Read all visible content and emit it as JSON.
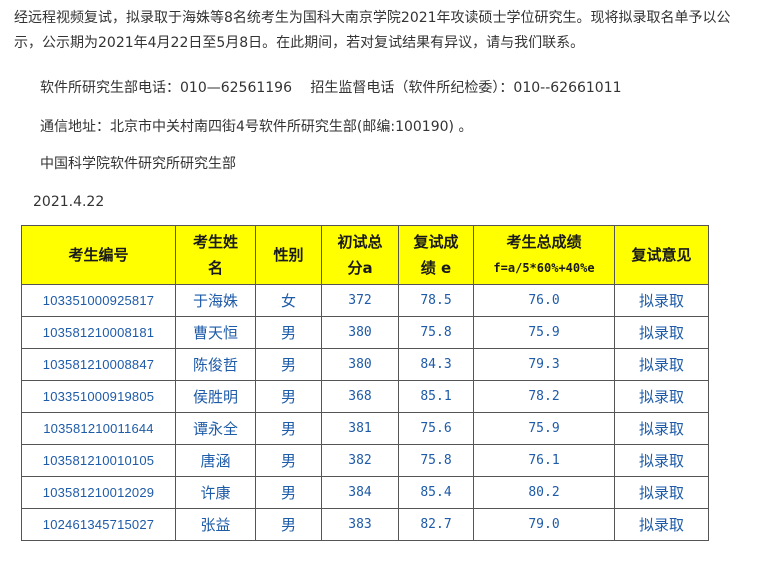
{
  "notice": {
    "intro": "经远程视频复试，拟录取于海姝等8名统考生为国科大南京学院2021年攻读硕士学位研究生。现将拟录取名单予以公示，公示期为2021年4月22日至5月8日。在此期间，若对复试结果有异议，请与我们联系。",
    "contact": "软件所研究生部电话：010—62561196　 招生监督电话（软件所纪检委）：010--62661011",
    "address": "通信地址：北京市中关村南四街4号软件所研究生部(邮编:100190) 。",
    "org": "中国科学院软件研究所研究生部",
    "date": "2021.4.22"
  },
  "table": {
    "headers": {
      "id": "考生编号",
      "name_line1": "考生姓",
      "name_line2": "名",
      "gender": "性别",
      "initial_line1": "初试总",
      "initial_line2": "分a",
      "retest_line1": "复试成",
      "retest_line2": "绩 e",
      "total_line1": "考生总成绩",
      "total_line2": "f=a/5*60%+40%e",
      "opinion": "复试意见"
    },
    "rows": [
      {
        "id": "103351000925817",
        "name": "于海姝",
        "gender": "女",
        "initial": "372",
        "retest": "78.5",
        "total": "76.0",
        "opinion": "拟录取"
      },
      {
        "id": "103581210008181",
        "name": "曹天恒",
        "gender": "男",
        "initial": "380",
        "retest": "75.8",
        "total": "75.9",
        "opinion": "拟录取"
      },
      {
        "id": "103581210008847",
        "name": "陈俊哲",
        "gender": "男",
        "initial": "380",
        "retest": "84.3",
        "total": "79.3",
        "opinion": "拟录取"
      },
      {
        "id": "103351000919805",
        "name": "侯胜明",
        "gender": "男",
        "initial": "368",
        "retest": "85.1",
        "total": "78.2",
        "opinion": "拟录取"
      },
      {
        "id": "103581210011644",
        "name": "谭永全",
        "gender": "男",
        "initial": "381",
        "retest": "75.6",
        "total": "75.9",
        "opinion": "拟录取"
      },
      {
        "id": "103581210010105",
        "name": "唐涵",
        "gender": "男",
        "initial": "382",
        "retest": "75.8",
        "total": "76.1",
        "opinion": "拟录取"
      },
      {
        "id": "103581210012029",
        "name": "许康",
        "gender": "男",
        "initial": "384",
        "retest": "85.4",
        "total": "80.2",
        "opinion": "拟录取"
      },
      {
        "id": "102461345715027",
        "name": "张益",
        "gender": "男",
        "initial": "383",
        "retest": "82.7",
        "total": "79.0",
        "opinion": "拟录取"
      }
    ]
  },
  "colors": {
    "header_bg": "#ffff00",
    "cell_text": "#1e5ba8",
    "body_text": "#333333"
  }
}
